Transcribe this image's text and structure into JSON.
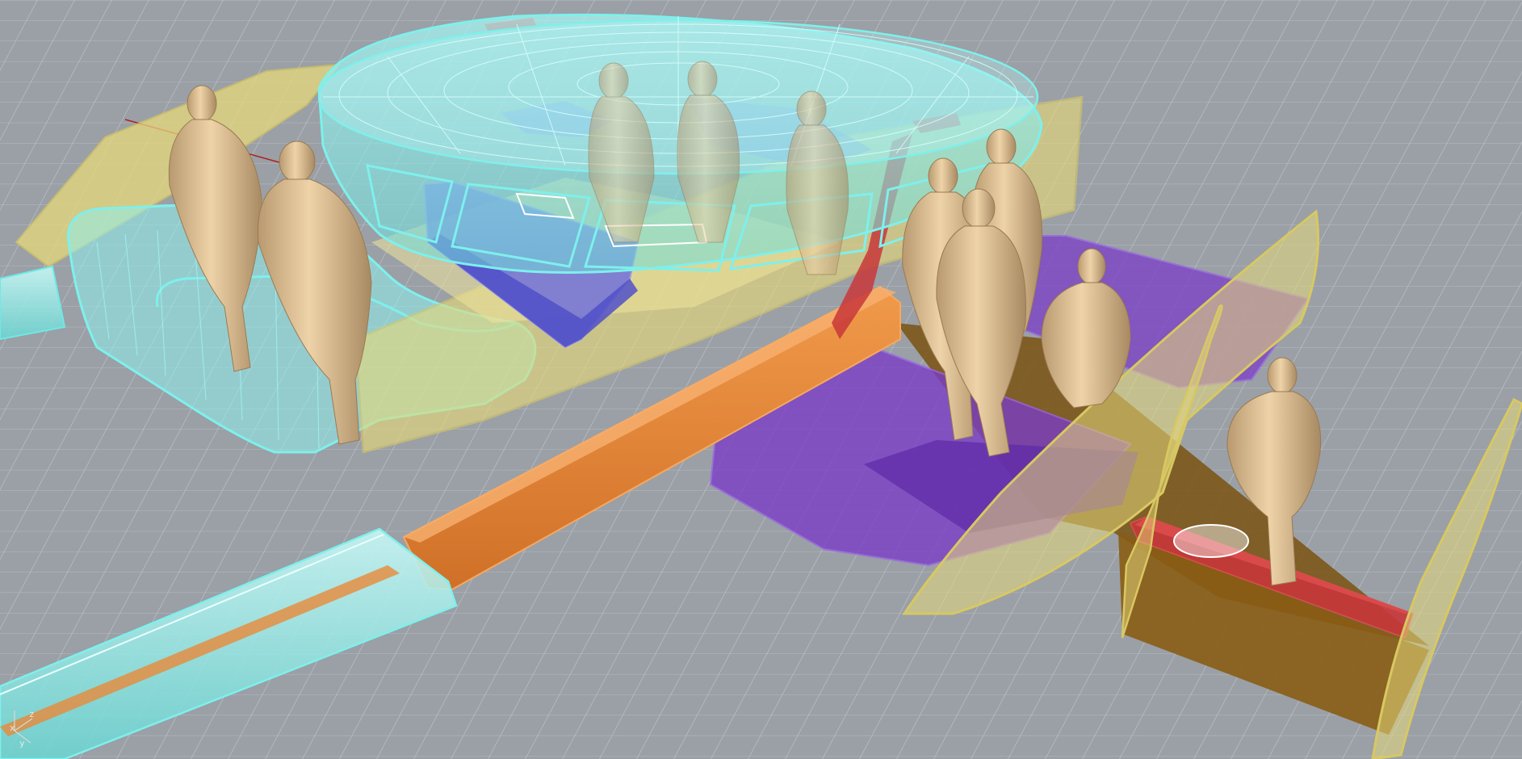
{
  "viewport": {
    "name": "Perspective",
    "background_color": "#9aa0a6",
    "grid_color": "#c9ced3"
  },
  "axis_indicator": {
    "x_label": "x",
    "y_label": "y",
    "z_label": "z"
  },
  "materials": {
    "cyan_glass": "#8ff0ee",
    "yellow_hull": "#e6d97a",
    "orange_beam": "#e88a3a",
    "purple_panel": "#7a3cc8",
    "blue_seat": "#6a6ae0",
    "red_strut": "#c8373a",
    "brown_floor": "#7a5210",
    "figure_tan": "#d9b98c"
  }
}
